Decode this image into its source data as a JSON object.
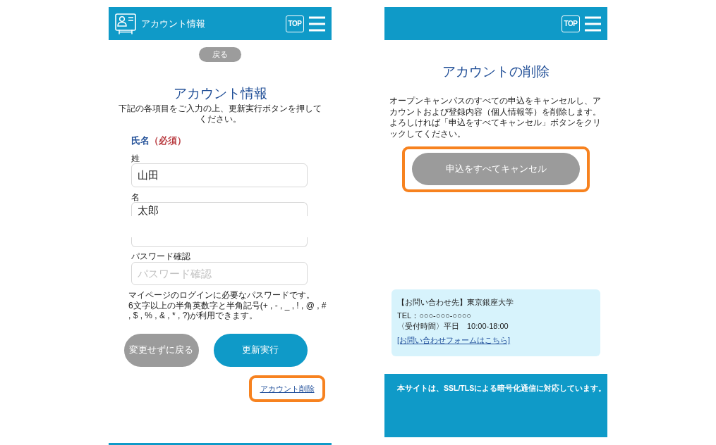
{
  "account_info_screen": {
    "header": {
      "title": "アカウント情報",
      "top_label": "TOP"
    },
    "back_button": "戻る",
    "title": "アカウント情報",
    "intro": "下記の各項目をご入力の上、更新実行ボタンを押してください。",
    "section": {
      "label": "氏名",
      "required": "（必須）"
    },
    "fields": [
      {
        "kind": "full",
        "label": "姓",
        "value": "山田"
      },
      {
        "kind": "top",
        "label": "名",
        "value": "太郎"
      },
      {
        "kind": "bottom"
      },
      {
        "kind": "full",
        "label": "パスワード確認",
        "placeholder": "パスワード確認"
      }
    ],
    "password_note": "マイページのログインに必要なパスワードです。\n6文字以上の半角英数字と半角記号(+ , - , _ , ! , @ , # , $ , % , & , * , ?)が利用できます。",
    "buttons": [
      {
        "kind": "secondary",
        "label": "変更せずに戻る"
      },
      {
        "kind": "primary",
        "label": "更新実行"
      }
    ],
    "delete_link": {
      "label": "アカウント削除",
      "highlighted": true
    }
  },
  "account_delete_screen": {
    "header": {
      "top_label": "TOP"
    },
    "title": "アカウントの削除",
    "description": "オープンキャンパスのすべての申込をキャンセルし、アカウントおよび登録内容（個人情報等）を削除します。よろしければ「申込をすべてキャンセル」ボタンをクリックしてください。",
    "cancel_button": {
      "label": "申込をすべてキャンセル",
      "highlighted": true
    },
    "contact": {
      "lines": [
        "【お問い合わせ先】東京銀座大学",
        "TEL：○○○-○○○-○○○○",
        "〈受付時間〉平日　10:00-18:00"
      ],
      "link": "[お問い合わせフォームはこちら]"
    },
    "footer": "本サイトは、SSL/TLSによる暗号化通信に対応しています。"
  }
}
